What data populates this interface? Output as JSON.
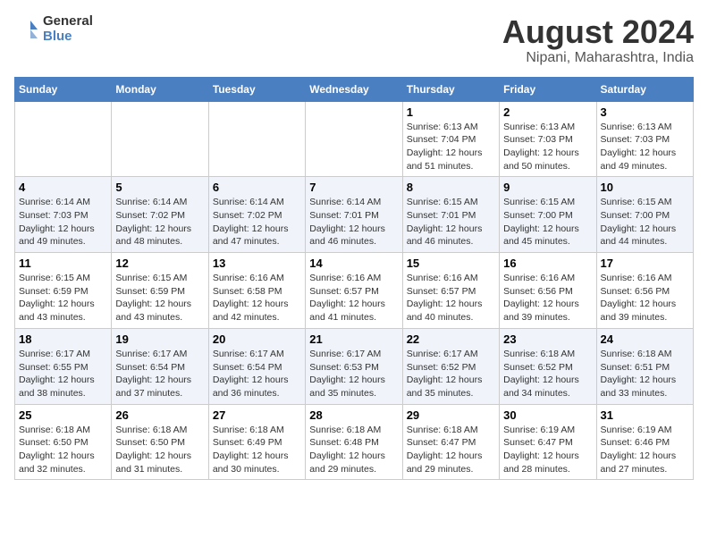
{
  "logo": {
    "general": "General",
    "blue": "Blue"
  },
  "title": "August 2024",
  "subtitle": "Nipani, Maharashtra, India",
  "days_of_week": [
    "Sunday",
    "Monday",
    "Tuesday",
    "Wednesday",
    "Thursday",
    "Friday",
    "Saturday"
  ],
  "weeks": [
    [
      {
        "num": "",
        "info": ""
      },
      {
        "num": "",
        "info": ""
      },
      {
        "num": "",
        "info": ""
      },
      {
        "num": "",
        "info": ""
      },
      {
        "num": "1",
        "info": "Sunrise: 6:13 AM\nSunset: 7:04 PM\nDaylight: 12 hours and 51 minutes."
      },
      {
        "num": "2",
        "info": "Sunrise: 6:13 AM\nSunset: 7:03 PM\nDaylight: 12 hours and 50 minutes."
      },
      {
        "num": "3",
        "info": "Sunrise: 6:13 AM\nSunset: 7:03 PM\nDaylight: 12 hours and 49 minutes."
      }
    ],
    [
      {
        "num": "4",
        "info": "Sunrise: 6:14 AM\nSunset: 7:03 PM\nDaylight: 12 hours and 49 minutes."
      },
      {
        "num": "5",
        "info": "Sunrise: 6:14 AM\nSunset: 7:02 PM\nDaylight: 12 hours and 48 minutes."
      },
      {
        "num": "6",
        "info": "Sunrise: 6:14 AM\nSunset: 7:02 PM\nDaylight: 12 hours and 47 minutes."
      },
      {
        "num": "7",
        "info": "Sunrise: 6:14 AM\nSunset: 7:01 PM\nDaylight: 12 hours and 46 minutes."
      },
      {
        "num": "8",
        "info": "Sunrise: 6:15 AM\nSunset: 7:01 PM\nDaylight: 12 hours and 46 minutes."
      },
      {
        "num": "9",
        "info": "Sunrise: 6:15 AM\nSunset: 7:00 PM\nDaylight: 12 hours and 45 minutes."
      },
      {
        "num": "10",
        "info": "Sunrise: 6:15 AM\nSunset: 7:00 PM\nDaylight: 12 hours and 44 minutes."
      }
    ],
    [
      {
        "num": "11",
        "info": "Sunrise: 6:15 AM\nSunset: 6:59 PM\nDaylight: 12 hours and 43 minutes."
      },
      {
        "num": "12",
        "info": "Sunrise: 6:15 AM\nSunset: 6:59 PM\nDaylight: 12 hours and 43 minutes."
      },
      {
        "num": "13",
        "info": "Sunrise: 6:16 AM\nSunset: 6:58 PM\nDaylight: 12 hours and 42 minutes."
      },
      {
        "num": "14",
        "info": "Sunrise: 6:16 AM\nSunset: 6:57 PM\nDaylight: 12 hours and 41 minutes."
      },
      {
        "num": "15",
        "info": "Sunrise: 6:16 AM\nSunset: 6:57 PM\nDaylight: 12 hours and 40 minutes."
      },
      {
        "num": "16",
        "info": "Sunrise: 6:16 AM\nSunset: 6:56 PM\nDaylight: 12 hours and 39 minutes."
      },
      {
        "num": "17",
        "info": "Sunrise: 6:16 AM\nSunset: 6:56 PM\nDaylight: 12 hours and 39 minutes."
      }
    ],
    [
      {
        "num": "18",
        "info": "Sunrise: 6:17 AM\nSunset: 6:55 PM\nDaylight: 12 hours and 38 minutes."
      },
      {
        "num": "19",
        "info": "Sunrise: 6:17 AM\nSunset: 6:54 PM\nDaylight: 12 hours and 37 minutes."
      },
      {
        "num": "20",
        "info": "Sunrise: 6:17 AM\nSunset: 6:54 PM\nDaylight: 12 hours and 36 minutes."
      },
      {
        "num": "21",
        "info": "Sunrise: 6:17 AM\nSunset: 6:53 PM\nDaylight: 12 hours and 35 minutes."
      },
      {
        "num": "22",
        "info": "Sunrise: 6:17 AM\nSunset: 6:52 PM\nDaylight: 12 hours and 35 minutes."
      },
      {
        "num": "23",
        "info": "Sunrise: 6:18 AM\nSunset: 6:52 PM\nDaylight: 12 hours and 34 minutes."
      },
      {
        "num": "24",
        "info": "Sunrise: 6:18 AM\nSunset: 6:51 PM\nDaylight: 12 hours and 33 minutes."
      }
    ],
    [
      {
        "num": "25",
        "info": "Sunrise: 6:18 AM\nSunset: 6:50 PM\nDaylight: 12 hours and 32 minutes."
      },
      {
        "num": "26",
        "info": "Sunrise: 6:18 AM\nSunset: 6:50 PM\nDaylight: 12 hours and 31 minutes."
      },
      {
        "num": "27",
        "info": "Sunrise: 6:18 AM\nSunset: 6:49 PM\nDaylight: 12 hours and 30 minutes."
      },
      {
        "num": "28",
        "info": "Sunrise: 6:18 AM\nSunset: 6:48 PM\nDaylight: 12 hours and 29 minutes."
      },
      {
        "num": "29",
        "info": "Sunrise: 6:18 AM\nSunset: 6:47 PM\nDaylight: 12 hours and 29 minutes."
      },
      {
        "num": "30",
        "info": "Sunrise: 6:19 AM\nSunset: 6:47 PM\nDaylight: 12 hours and 28 minutes."
      },
      {
        "num": "31",
        "info": "Sunrise: 6:19 AM\nSunset: 6:46 PM\nDaylight: 12 hours and 27 minutes."
      }
    ]
  ]
}
